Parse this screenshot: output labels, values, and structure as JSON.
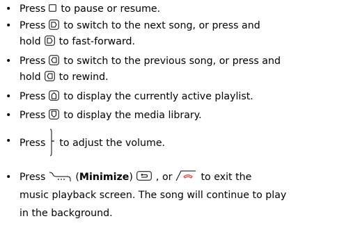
{
  "items": [
    {
      "press": "Press",
      "rest": "to pause or resume."
    },
    {
      "press": "Press",
      "mid": "to switch to the next song, or press and",
      "line2_start": "hold",
      "rest": "to fast-forward."
    },
    {
      "press": "Press",
      "mid": "to switch to the previous song, or press and",
      "line2_start": "hold",
      "rest": "to rewind."
    },
    {
      "press": "Press",
      "rest": "to display the currently active playlist."
    },
    {
      "press": "Press",
      "rest": "to display the media library."
    },
    {
      "press": "Press",
      "rest": "to adjust the volume."
    },
    {
      "press": "Press",
      "minimize": "Minimize",
      "sep1": ",",
      "or": "or",
      "rest": "to exit the",
      "line2": "music playback screen. The song will continue to play",
      "line3": "in the background."
    }
  ],
  "bullet_char": "•",
  "icons": {
    "pause": "square-outline-icon",
    "next": "next-song-key-icon",
    "prev": "previous-song-key-icon",
    "playlist": "playlist-key-icon",
    "library": "library-key-icon",
    "volume": "volume-side-key-icon",
    "minimize": "minimize-softkey-icon",
    "back": "back-key-icon",
    "end": "end-call-key-icon"
  },
  "colors": {
    "text": "#000000",
    "end_key": "#e0322e"
  }
}
